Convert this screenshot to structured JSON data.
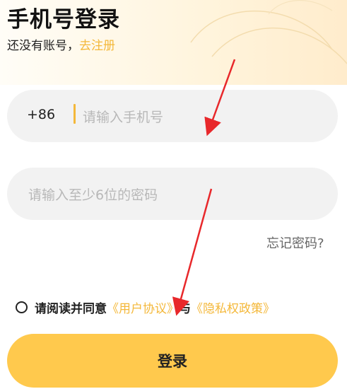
{
  "header": {
    "title": "手机号登录",
    "subtitle_prefix": "还没有账号，",
    "register_link": "去注册"
  },
  "phone_field": {
    "country_code": "+86",
    "placeholder": "请输入手机号"
  },
  "password_field": {
    "placeholder": "请输入至少6位的密码"
  },
  "forgot_password": "忘记密码?",
  "agreement": {
    "prefix": "请阅读并同意",
    "user_agreement": "《用户协议》",
    "and": "与",
    "privacy_policy": "《隐私权政策》"
  },
  "login_button": "登录",
  "colors": {
    "accent": "#f4b83a",
    "button": "#ffc94d",
    "field_bg": "#f2f2f2",
    "annotation_arrow": "#e8282b"
  }
}
